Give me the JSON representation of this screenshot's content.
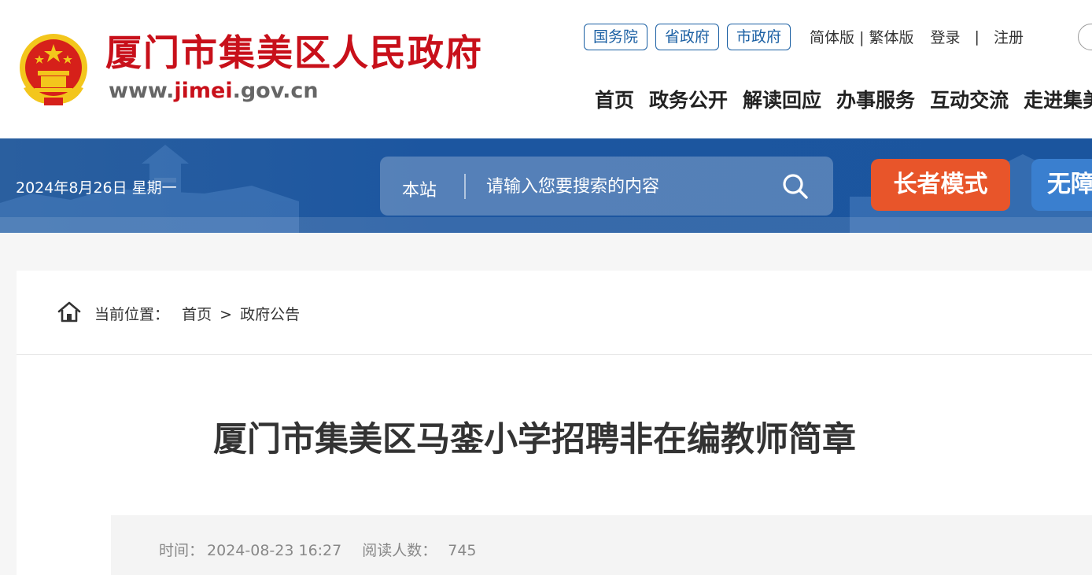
{
  "header": {
    "site_name": "厦门市集美区人民政府",
    "site_url_prefix": "www.",
    "site_url_brand": "jimei",
    "site_url_suffix": ".gov.cn",
    "gov_links": [
      "国务院",
      "省政府",
      "市政府"
    ],
    "lang_label": "简体版 | 繁体版",
    "login": "登录",
    "separator": "|",
    "register": "注册",
    "nav": [
      "首页",
      "政务公开",
      "解读回应",
      "办事服务",
      "互动交流",
      "走进集美"
    ]
  },
  "banner": {
    "date": "2024年8月26日 星期一",
    "search_scope": "本站",
    "search_placeholder": "请输入您要搜索的内容",
    "elder_mode": "长者模式",
    "accessibility": "无障碍"
  },
  "breadcrumb": {
    "label": "当前位置：",
    "home": "首页",
    "arrow": ">",
    "current": "政府公告"
  },
  "article": {
    "title": "厦门市集美区马銮小学招聘非在编教师简章",
    "time_label": "时间：",
    "time_value": "2024-08-23 16:27",
    "reads_label": "阅读人数：",
    "reads_value": "745"
  },
  "colors": {
    "brand_red": "#c8101a",
    "banner_blue": "#1c56a0",
    "elder_orange": "#e8552a"
  }
}
